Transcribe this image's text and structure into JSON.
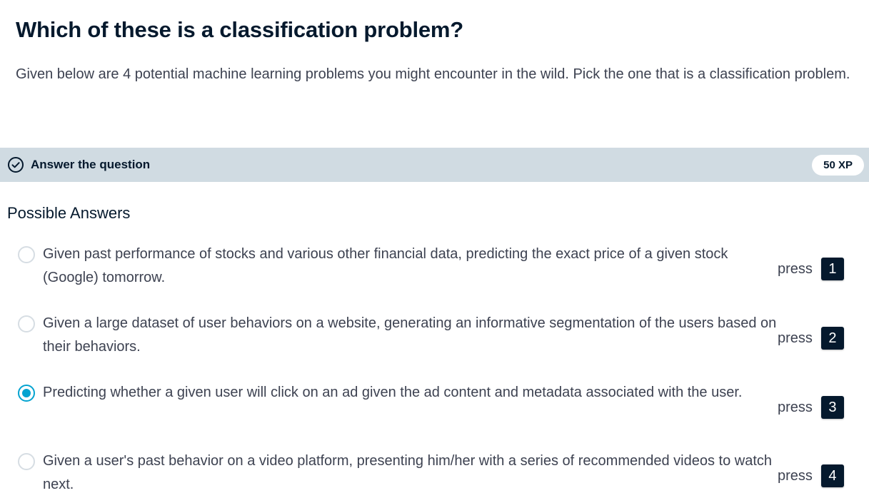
{
  "exercise": {
    "title": "Which of these is a classification problem?",
    "description": "Given below are 4 potential machine learning problems you might encounter in the wild. Pick the one that is a classification problem."
  },
  "task_bar": {
    "label": "Answer the question",
    "xp": "50 XP",
    "icon": "checkmark-circle-icon"
  },
  "answers_section": {
    "heading": "Possible Answers",
    "selected_index": 2,
    "items": [
      {
        "text": "Given past performance of stocks and various other financial data, predicting the exact price of a given stock (Google) tomorrow.",
        "press_label": "press",
        "key": "1",
        "selected": false
      },
      {
        "text": "Given a large dataset of user behaviors on a website, generating an informative segmentation of the users based on their behaviors.",
        "press_label": "press",
        "key": "2",
        "selected": false
      },
      {
        "text": "Predicting whether a given user will click on an ad given the ad content and metadata associated with the user.",
        "press_label": "press",
        "key": "3",
        "selected": true
      },
      {
        "text": "Given a user's past behavior on a video platform, presenting him/her with a series of recommended videos to watch next.",
        "press_label": "press",
        "key": "4",
        "selected": false
      }
    ]
  },
  "colors": {
    "text_dark": "#05192d",
    "text_body": "#3d4251",
    "bar_bg": "#d0dbe2",
    "radio_selected": "#03a3d0",
    "key_badge_bg": "#05192d"
  }
}
